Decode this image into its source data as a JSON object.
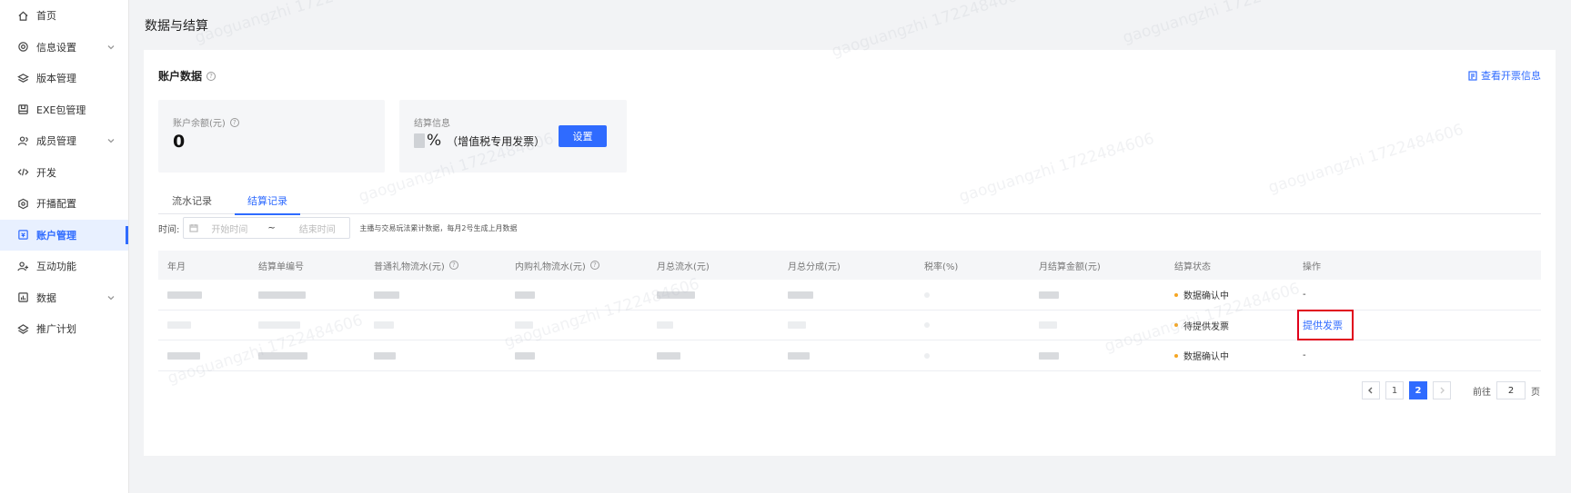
{
  "sidebar": {
    "items": [
      {
        "label": "首页",
        "icon": "home-icon"
      },
      {
        "label": "信息设置",
        "icon": "settings-icon",
        "expandable": true
      },
      {
        "label": "版本管理",
        "icon": "layers-icon"
      },
      {
        "label": "EXE包管理",
        "icon": "package-icon"
      },
      {
        "label": "成员管理",
        "icon": "users-icon",
        "expandable": true
      },
      {
        "label": "开发",
        "icon": "code-icon"
      },
      {
        "label": "开播配置",
        "icon": "broadcast-icon"
      },
      {
        "label": "账户管理",
        "icon": "wallet-icon",
        "active": true
      },
      {
        "label": "互动功能",
        "icon": "interaction-icon"
      },
      {
        "label": "数据",
        "icon": "chart-icon",
        "expandable": true
      },
      {
        "label": "推广计划",
        "icon": "promo-icon"
      }
    ]
  },
  "page": {
    "title": "数据与结算"
  },
  "account": {
    "title": "账户数据",
    "invoice_link": "查看开票信息",
    "balance_label": "账户余额(元)",
    "balance_value": "0",
    "settle_label": "结算信息",
    "settle_pct": "%",
    "settle_type": "（增值税专用发票）",
    "settle_button": "设置"
  },
  "tabs": [
    {
      "label": "流水记录"
    },
    {
      "label": "结算记录",
      "active": true
    }
  ],
  "filter": {
    "label": "时间",
    "start_placeholder": "开始时间",
    "separator": "~",
    "end_placeholder": "结束时间",
    "hint": "主播与交易玩法累计数据，每月2号生成上月数据"
  },
  "table": {
    "columns": [
      "年月",
      "结算单编号",
      "普通礼物流水(元)",
      "内购礼物流水(元)",
      "月总流水(元)",
      "月总分成(元)",
      "税率(%)",
      "月结算金额(元)",
      "结算状态",
      "操作"
    ],
    "rows": [
      {
        "status": "数据确认中",
        "action": "-"
      },
      {
        "status": "待提供发票",
        "action": "提供发票"
      },
      {
        "status": "数据确认中",
        "action": "-"
      }
    ]
  },
  "pagination": {
    "pages": [
      "1",
      "2"
    ],
    "current": "2",
    "goto_prefix": "前往",
    "goto_value": "2",
    "goto_suffix": "页"
  },
  "watermark": {
    "text": "gaoguangzhi 1722484606"
  },
  "colors": {
    "accent": "#2f6bff",
    "status_dot": "#f5a623",
    "highlight": "#e0001b"
  }
}
